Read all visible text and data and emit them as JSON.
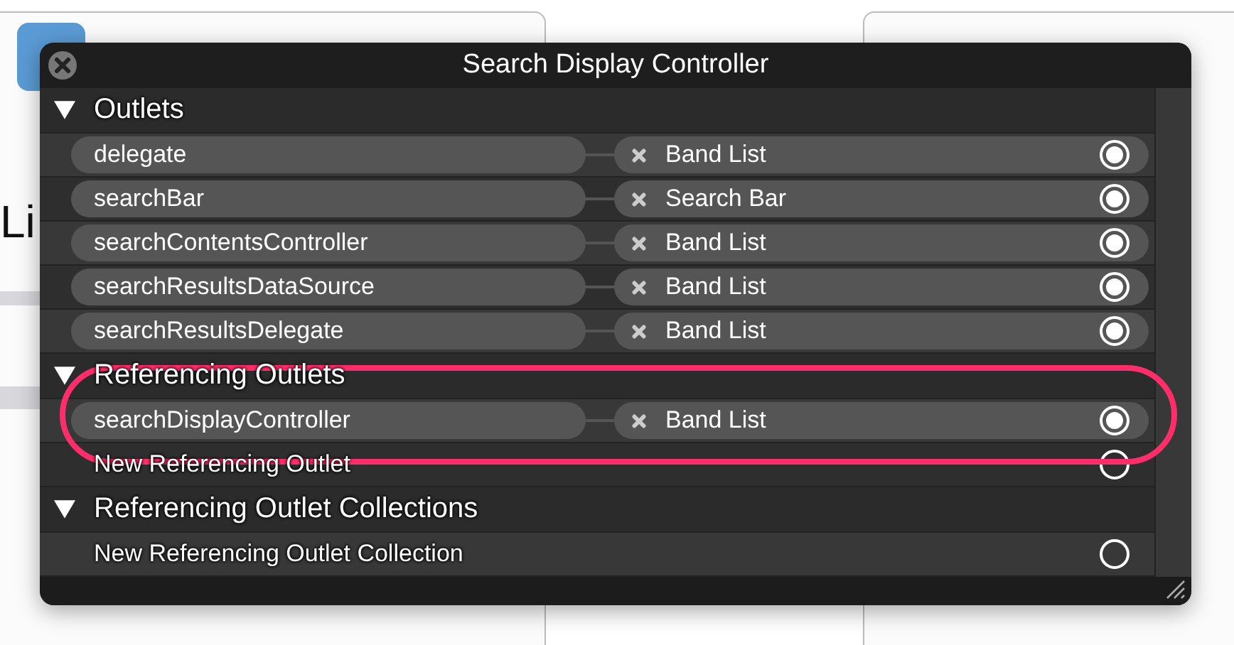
{
  "background_label": "Li",
  "window": {
    "title": "Search Display Controller"
  },
  "sections": [
    {
      "title": "Outlets",
      "expanded": true,
      "rows": [
        {
          "kind": "connection",
          "name": "delegate",
          "target": "Band List",
          "connected": true
        },
        {
          "kind": "connection",
          "name": "searchBar",
          "target": "Search Bar",
          "connected": true
        },
        {
          "kind": "connection",
          "name": "searchContentsController",
          "target": "Band List",
          "connected": true
        },
        {
          "kind": "connection",
          "name": "searchResultsDataSource",
          "target": "Band List",
          "connected": true
        },
        {
          "kind": "connection",
          "name": "searchResultsDelegate",
          "target": "Band List",
          "connected": true
        }
      ]
    },
    {
      "title": "Referencing Outlets",
      "expanded": true,
      "rows": [
        {
          "kind": "connection",
          "name": "searchDisplayController",
          "target": "Band List",
          "connected": true
        },
        {
          "kind": "new",
          "name": "New Referencing Outlet",
          "connected": false
        }
      ]
    },
    {
      "title": "Referencing Outlet Collections",
      "expanded": true,
      "rows": [
        {
          "kind": "new",
          "name": "New Referencing Outlet Collection",
          "connected": false
        }
      ]
    }
  ]
}
